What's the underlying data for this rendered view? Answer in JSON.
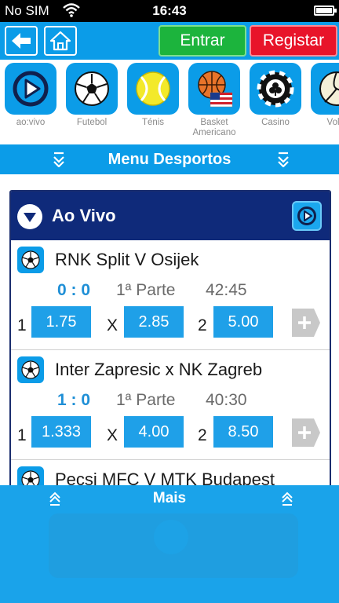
{
  "status_bar": {
    "carrier": "No SIM",
    "time": "16:43"
  },
  "nav": {
    "login_label": "Entrar",
    "register_label": "Registar"
  },
  "sports": [
    {
      "label": "ao:vivo",
      "icon": "live-play-icon"
    },
    {
      "label": "Futebol",
      "icon": "soccer-ball-icon"
    },
    {
      "label": "Ténis",
      "icon": "tennis-ball-icon"
    },
    {
      "label": "Basket Americano",
      "icon": "basketball-usa-icon"
    },
    {
      "label": "Casino",
      "icon": "casino-chip-icon"
    },
    {
      "label": "Volei",
      "icon": "volleyball-icon"
    }
  ],
  "menu_bar": {
    "title": "Menu Desportos"
  },
  "live": {
    "title": "Ao Vivo",
    "matches": [
      {
        "teams": "RNK Split V Osijek",
        "score": "0 : 0",
        "period": "1ª Parte",
        "clock": "42:45",
        "odds": [
          {
            "sel": "1",
            "value": "1.75"
          },
          {
            "sel": "X",
            "value": "2.85"
          },
          {
            "sel": "2",
            "value": "5.00"
          }
        ]
      },
      {
        "teams": "Inter Zapresic x NK Zagreb",
        "score": "1 : 0",
        "period": "1ª Parte",
        "clock": "40:30",
        "odds": [
          {
            "sel": "1",
            "value": "1.333"
          },
          {
            "sel": "X",
            "value": "4.00"
          },
          {
            "sel": "2",
            "value": "8.50"
          }
        ]
      },
      {
        "teams": "Pecsi MFC V MTK Budapest"
      }
    ]
  },
  "bottom_bar": {
    "title": "Mais"
  },
  "colors": {
    "primary_blue": "#0b9ce8",
    "navy": "#0f2a7a",
    "green": "#1cb43d",
    "red": "#e8142a"
  }
}
